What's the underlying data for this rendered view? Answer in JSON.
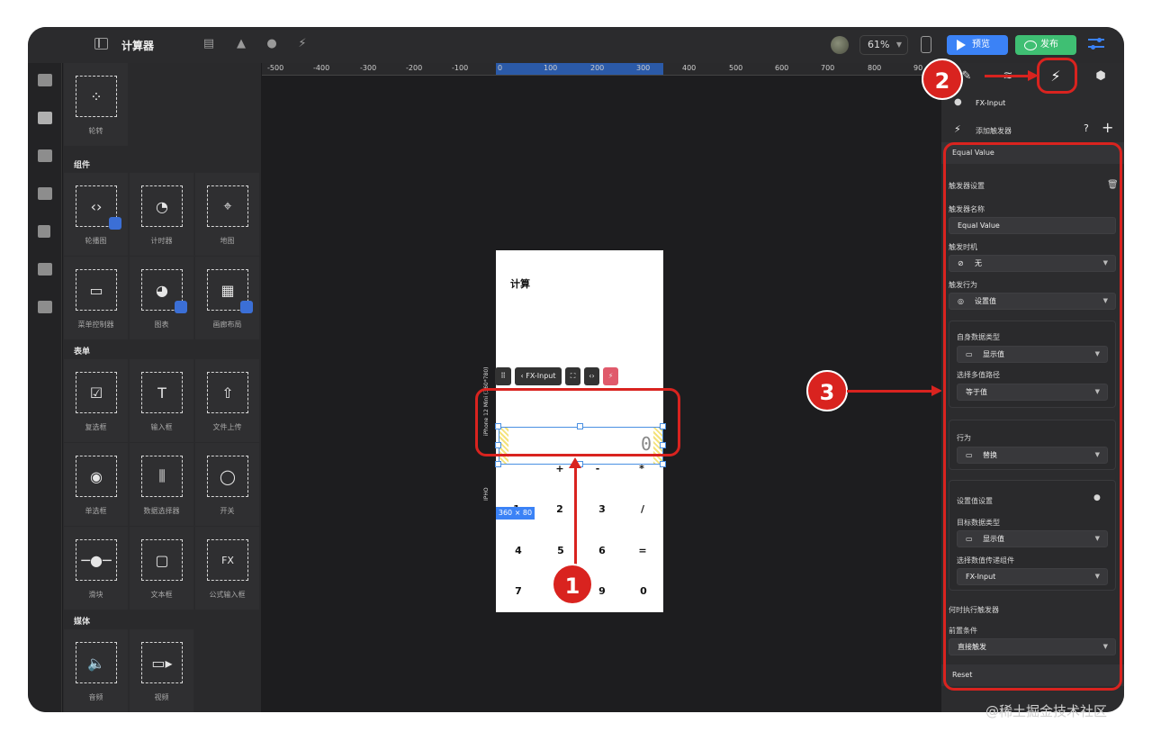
{
  "app": {
    "title": "计算器"
  },
  "toolbar": {
    "zoom": "61%",
    "preview_label": "预览",
    "publish_label": "发布"
  },
  "library": {
    "carousel_label": "轮转",
    "sections": [
      "组件",
      "表单",
      "媒体"
    ],
    "components": [
      "轮播图",
      "计时器",
      "地图",
      "菜单控制器",
      "图表",
      "画廊布局"
    ],
    "forms": [
      "复选框",
      "输入框",
      "文件上传",
      "单选框",
      "数据选择器",
      "开关",
      "滑块",
      "文本框",
      "公式输入框"
    ],
    "media": [
      "音频",
      "视频"
    ]
  },
  "ruler": {
    "labels": [
      "-500",
      "-400",
      "-300",
      "-200",
      "-100",
      "0",
      "100",
      "200",
      "300",
      "400",
      "500",
      "600",
      "700",
      "800",
      "90"
    ]
  },
  "phone": {
    "title": "计算",
    "device_label": "iPhone 12 Mini (360*780)",
    "device_label2": "IPHO",
    "input_value": "0",
    "size_badge": "360 × 80",
    "keys_row1": [
      "+",
      "-",
      "*"
    ],
    "keys_row2": [
      "1",
      "2",
      "3",
      "/"
    ],
    "keys_row3": [
      "4",
      "5",
      "6",
      "="
    ],
    "keys_row4": [
      "7",
      "9",
      "0"
    ]
  },
  "mini_toolbar": {
    "component": "FX-Input"
  },
  "callouts": [
    "1",
    "2",
    "3"
  ],
  "panel": {
    "component_name": "FX-Input",
    "add_trigger": "添加触发器",
    "trigger_title": "Equal Value",
    "trigger_settings": "触发器设置",
    "trigger_name_label": "触发器名称",
    "trigger_name_value": "Equal Value",
    "timing_label": "触发时机",
    "timing_value": "无",
    "action_label": "触发行为",
    "action_value": "设置值",
    "self_type_label": "自身数据类型",
    "self_type_value": "显示值",
    "path_label": "选择多值路径",
    "path_value": "等于值",
    "behavior_label": "行为",
    "behavior_value": "替换",
    "set_value_settings": "设置值设置",
    "target_type_label": "目标数据类型",
    "target_type_value": "显示值",
    "target_comp_label": "选择数值传递组件",
    "target_comp_value": "FX-Input",
    "when_label": "何时执行触发器",
    "precondition_label": "前置条件",
    "precondition_value": "直接触发",
    "reset_label": "Reset"
  },
  "watermark": "@稀土掘金技术社区"
}
